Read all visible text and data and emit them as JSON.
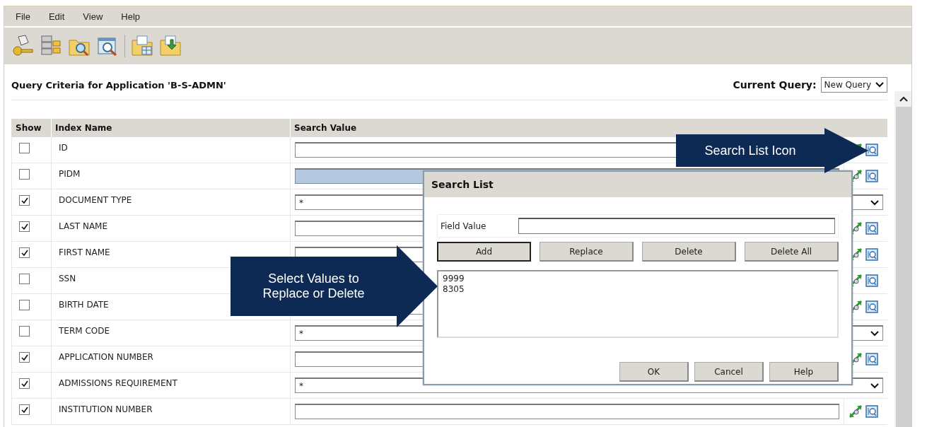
{
  "menu": [
    "File",
    "Edit",
    "View",
    "Help"
  ],
  "toolbar": [
    {
      "kind": "key"
    },
    {
      "kind": "database"
    },
    {
      "kind": "folder-search"
    },
    {
      "kind": "window-search"
    },
    {
      "kind": "separator"
    },
    {
      "kind": "folder-table"
    },
    {
      "kind": "folder-arrow"
    }
  ],
  "title": "Query Criteria for Application 'B-S-ADMN'",
  "current_query": {
    "label": "Current Query:",
    "value": "New Query"
  },
  "table": {
    "columns": [
      "Show",
      "Index Name",
      "Search Value"
    ],
    "rows": [
      {
        "name": "ID",
        "checked": false,
        "kind": "text"
      },
      {
        "name": "PIDM",
        "checked": false,
        "kind": "text",
        "focused": true
      },
      {
        "name": "DOCUMENT TYPE",
        "checked": true,
        "kind": "dropdown",
        "value": "*"
      },
      {
        "name": "LAST NAME",
        "checked": true,
        "kind": "text"
      },
      {
        "name": "FIRST NAME",
        "checked": true,
        "kind": "text"
      },
      {
        "name": "SSN",
        "checked": false,
        "kind": "icons-only"
      },
      {
        "name": "BIRTH DATE",
        "checked": false,
        "kind": "text"
      },
      {
        "name": "TERM CODE",
        "checked": false,
        "kind": "dropdown",
        "value": "*"
      },
      {
        "name": "APPLICATION NUMBER",
        "checked": true,
        "kind": "text"
      },
      {
        "name": "ADMISSIONS REQUIREMENT",
        "checked": true,
        "kind": "dropdown",
        "value": "*"
      },
      {
        "name": "INSTITUTION NUMBER",
        "checked": true,
        "kind": "text"
      }
    ]
  },
  "dialog": {
    "title": "Search List",
    "field_label": "Field Value",
    "buttons": [
      "Add",
      "Replace",
      "Delete",
      "Delete All"
    ],
    "list": [
      "9999",
      "8305"
    ],
    "footer": [
      "OK",
      "Cancel",
      "Help"
    ]
  },
  "callouts": [
    {
      "text": "Search List Icon"
    },
    {
      "text": "Select Values to Replace or Delete"
    }
  ]
}
